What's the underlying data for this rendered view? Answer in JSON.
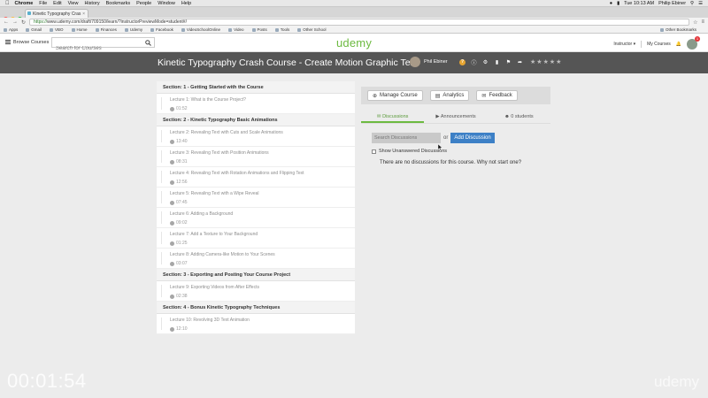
{
  "menubar": {
    "items": [
      "Chrome",
      "File",
      "Edit",
      "View",
      "History",
      "Bookmarks",
      "People",
      "Window",
      "Help"
    ],
    "clock": "Tue 10:13 AM",
    "user": "Philip Ebiner"
  },
  "browser": {
    "tab_title": "Kinetic Typography Cras",
    "url_secure": "https://",
    "url_rest": "www.udemy.com/draft/709150/learn/?instructorPreviewMode=student#/",
    "bookmarks": [
      "Apps",
      "Gmail",
      "VBO",
      "Home",
      "Finances",
      "Udemy",
      "Facebook",
      "VideoSchoolOnline",
      "Video",
      "Posts",
      "Tools",
      "Other School"
    ],
    "other_bookmarks": "Other Bookmarks"
  },
  "header": {
    "browse_label": "Browse Courses",
    "search_placeholder": "Search for Courses",
    "logo": "udemy",
    "instructor_label": "Instructor",
    "my_courses_label": "My Courses",
    "notification_count": "1"
  },
  "course": {
    "title": "Kinetic Typography Crash Course - Create Motion Graphic Text",
    "instructor": "Phil Ebiner"
  },
  "curriculum": [
    {
      "section": "Section: 1 - Getting Started with the Course",
      "lectures": [
        {
          "title": "Lecture 1: What is the Course Project?",
          "duration": "01:52"
        }
      ]
    },
    {
      "section": "Section: 2 - Kinetic Typography Basic Animations",
      "lectures": [
        {
          "title": "Lecture 2: Revealing Text with Cuts and Scale Animations",
          "duration": "13:40"
        },
        {
          "title": "Lecture 3: Revealing Text with Position Animations",
          "duration": "08:31"
        },
        {
          "title": "Lecture 4: Revealing Text with Rotation Animations and Flipping Text",
          "duration": "12:56"
        },
        {
          "title": "Lecture 5: Revealing Text with a Wipe Reveal",
          "duration": "07:45"
        },
        {
          "title": "Lecture 6: Adding a Background",
          "duration": "09:02"
        },
        {
          "title": "Lecture 7: Add a Texture to Your Background",
          "duration": "01:25"
        },
        {
          "title": "Lecture 8: Adding Camera-like Motion to Your Scenes",
          "duration": "03:07"
        }
      ]
    },
    {
      "section": "Section: 3 - Exporting and Posting Your Course Project",
      "lectures": [
        {
          "title": "Lecture 9: Exporting Videos from After Effects",
          "duration": "02:38"
        }
      ]
    },
    {
      "section": "Section: 4 - Bonus Kinetic Typography Techniques",
      "lectures": [
        {
          "title": "Lecture 10: Revolving 3D Text Animation",
          "duration": "12:10"
        }
      ]
    }
  ],
  "panel": {
    "manage_label": "Manage Course",
    "analytics_label": "Analytics",
    "feedback_label": "Feedback",
    "tab_discussions": "Discussions",
    "tab_announcements": "Announcements",
    "tab_students": "0 students",
    "search_placeholder": "Search Discussions",
    "or_label": "or",
    "add_discussion_label": "Add Discussion",
    "unanswered_label": "Show Unanswered Discussions",
    "empty_message": "There are no discussions for this course. Why not start one?"
  },
  "overlay": {
    "timer": "00:01:54",
    "watermark": "udemy"
  },
  "colors": {
    "brand_green": "#6cba40",
    "title_bar": "#555555",
    "primary_button": "#3d80c6"
  }
}
